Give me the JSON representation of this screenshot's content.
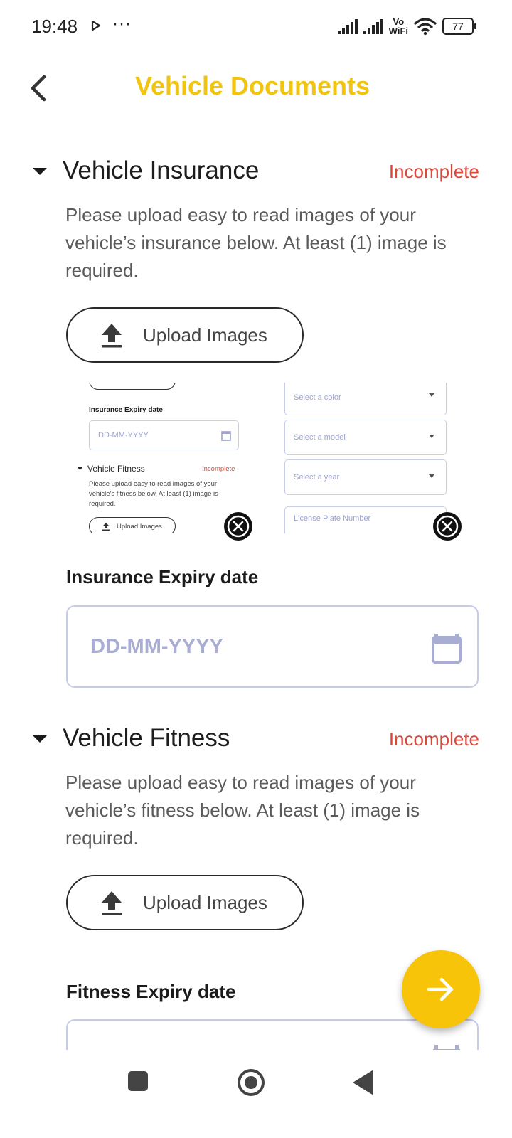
{
  "status_bar": {
    "time": "19:48",
    "dots": "···",
    "network_label_top": "Vo",
    "network_label_bottom": "WiFi",
    "battery": "77"
  },
  "app_bar": {
    "title": "Vehicle Documents",
    "title_color": "#F1C40F",
    "back_icon": "chevron-left-icon"
  },
  "sections": [
    {
      "title": "Vehicle Insurance",
      "status": "Incomplete",
      "status_color": "#D94A3D",
      "description": "Please upload easy to read images of your vehicle’s insurance below. At least (1) image is required.",
      "upload_label": "Upload Images",
      "expiry_label": "Insurance Expiry date",
      "expiry_placeholder": "DD-MM-YYYY"
    },
    {
      "title": "Vehicle Fitness",
      "status": "Incomplete",
      "description": "Please upload easy to read images of your vehicle’s fitness below. At least (1) image is required.",
      "upload_label": "Upload Images",
      "expiry_label": "Fitness Expiry date"
    }
  ],
  "thumbnails": [
    {
      "expiry_label": "Insurance Expiry date",
      "date_placeholder": "DD-MM-YYYY",
      "section_title": "Vehicle Fitness",
      "section_status": "Incomplete",
      "description_lines": [
        "Please upload easy to read images of your",
        "vehicle's fitness below. At least (1) image is",
        "required."
      ],
      "upload_label": "Upload Images"
    },
    {
      "color_placeholder": "Select a color",
      "model_placeholder": "Select a model",
      "year_placeholder": "Select a year",
      "plate_placeholder": "License Plate Number"
    }
  ],
  "fab": {
    "icon": "arrow-right-icon",
    "color": "#F7C40A"
  },
  "nav_bar": {
    "items": [
      "recents-square-icon",
      "home-circle-icon",
      "back-triangle-icon"
    ]
  }
}
